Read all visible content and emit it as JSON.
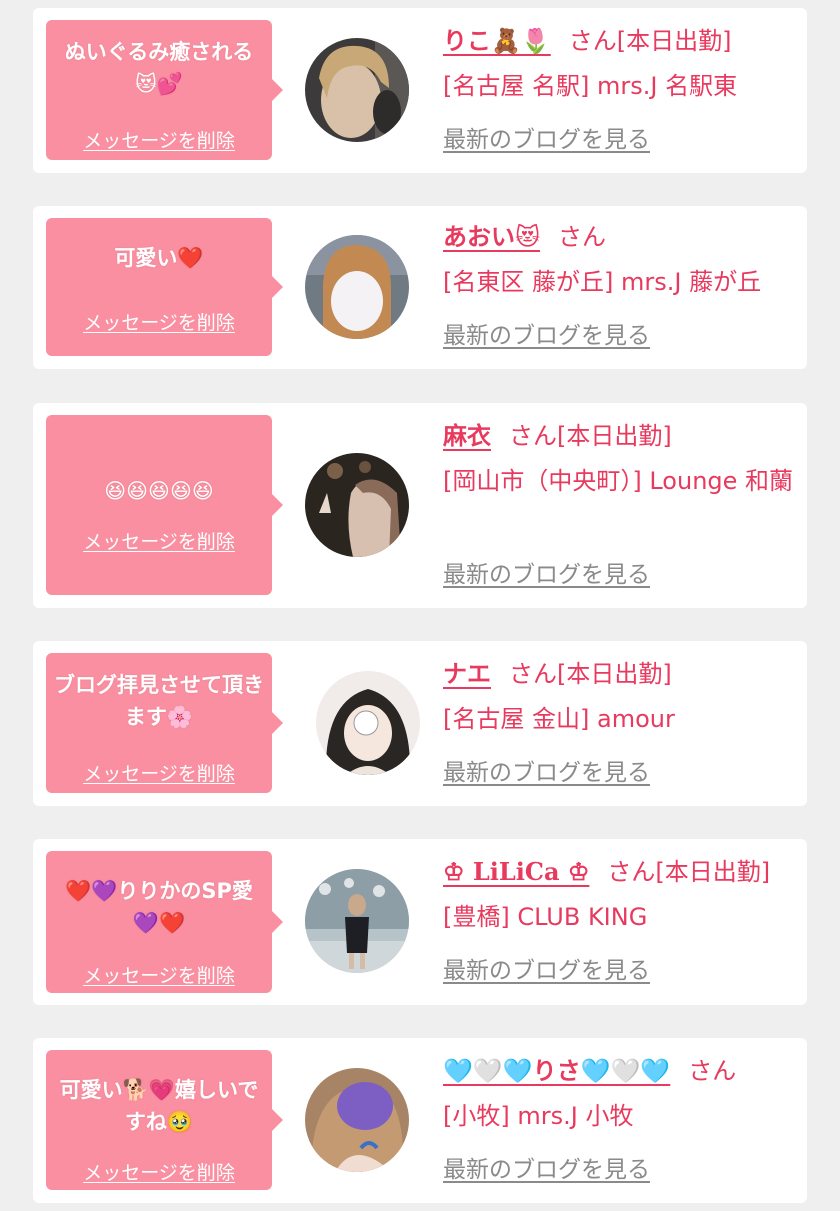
{
  "ui": {
    "delete_label": "メッセージを削除",
    "san_label": "さん",
    "blog_label": "最新のブログを見る"
  },
  "items": [
    {
      "message": "ぬいぐるみ癒される😻💕",
      "name": "りこ🧸🌷",
      "status": "[本日出勤]",
      "shop": "[名古屋 名駅] mrs.J 名駅東"
    },
    {
      "message": "可愛い❤️",
      "name": "あおい😻",
      "status": "",
      "shop": "[名東区 藤が丘] mrs.J 藤が丘"
    },
    {
      "message": "😆😆😆😆😆",
      "name": "麻衣",
      "status": "[本日出勤]",
      "shop": "[岡山市（中央町）] Lounge 和蘭"
    },
    {
      "message": "ブログ拝見させて頂きます🌸",
      "name": "ナエ",
      "status": "[本日出勤]",
      "shop": "[名古屋 金山] amour"
    },
    {
      "message": "❤️💜りりかのSP愛💜❤️",
      "name": "♔ LiLiCa ♔",
      "status": "[本日出勤]",
      "shop": "[豊橋] CLUB KING"
    },
    {
      "message": "可愛い🐕💗嬉しいですね🥹",
      "name": "🩵🤍🩵りさ🩵🤍🩵",
      "status": "",
      "shop": "[小牧] mrs.J 小牧"
    }
  ]
}
